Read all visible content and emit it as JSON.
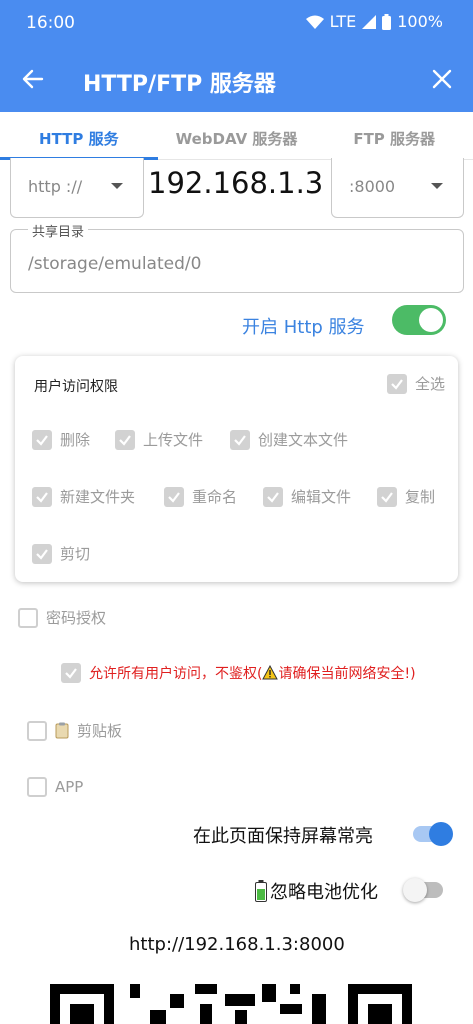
{
  "status_bar": {
    "time": "16:00",
    "network": "LTE",
    "battery": "100%"
  },
  "toolbar": {
    "title": "HTTP/FTP 服务器"
  },
  "tabs": [
    {
      "label": "HTTP 服务",
      "active": true
    },
    {
      "label": "WebDAV 服务器",
      "active": false
    },
    {
      "label": "FTP 服务器",
      "active": false
    }
  ],
  "server": {
    "protocol": "http ://",
    "ip": "192.168.1.3",
    "port": ":8000"
  },
  "share_dir": {
    "label": "共享目录",
    "value": "/storage/emulated/0"
  },
  "http_service": {
    "label": "开启 Http 服务",
    "enabled": true
  },
  "permissions": {
    "title": "用户访问权限",
    "select_all": "全选",
    "items": [
      "删除",
      "上传文件",
      "创建文本文件",
      "新建文件夹",
      "重命名",
      "编辑文件",
      "复制",
      "剪切"
    ]
  },
  "password_auth": {
    "label": "密码授权",
    "checked": false
  },
  "allow_all": {
    "label": "允许所有用户访问，不鉴权(",
    "warning": "请确保当前网络安全!)",
    "checked": true
  },
  "clipboard": {
    "label": "剪贴板",
    "checked": false
  },
  "app_option": {
    "label": "APP",
    "checked": false
  },
  "keep_screen_on": {
    "label": "在此页面保持屏幕常亮",
    "enabled": true
  },
  "battery_opt": {
    "label": "忽略电池优化",
    "enabled": false
  },
  "access_url": "http://192.168.1.3:8000",
  "colors": {
    "app_bar": "#4a8cf0",
    "accent": "#2f7de1",
    "toggle_on": "#4cbb66",
    "warning": "#e02020"
  }
}
